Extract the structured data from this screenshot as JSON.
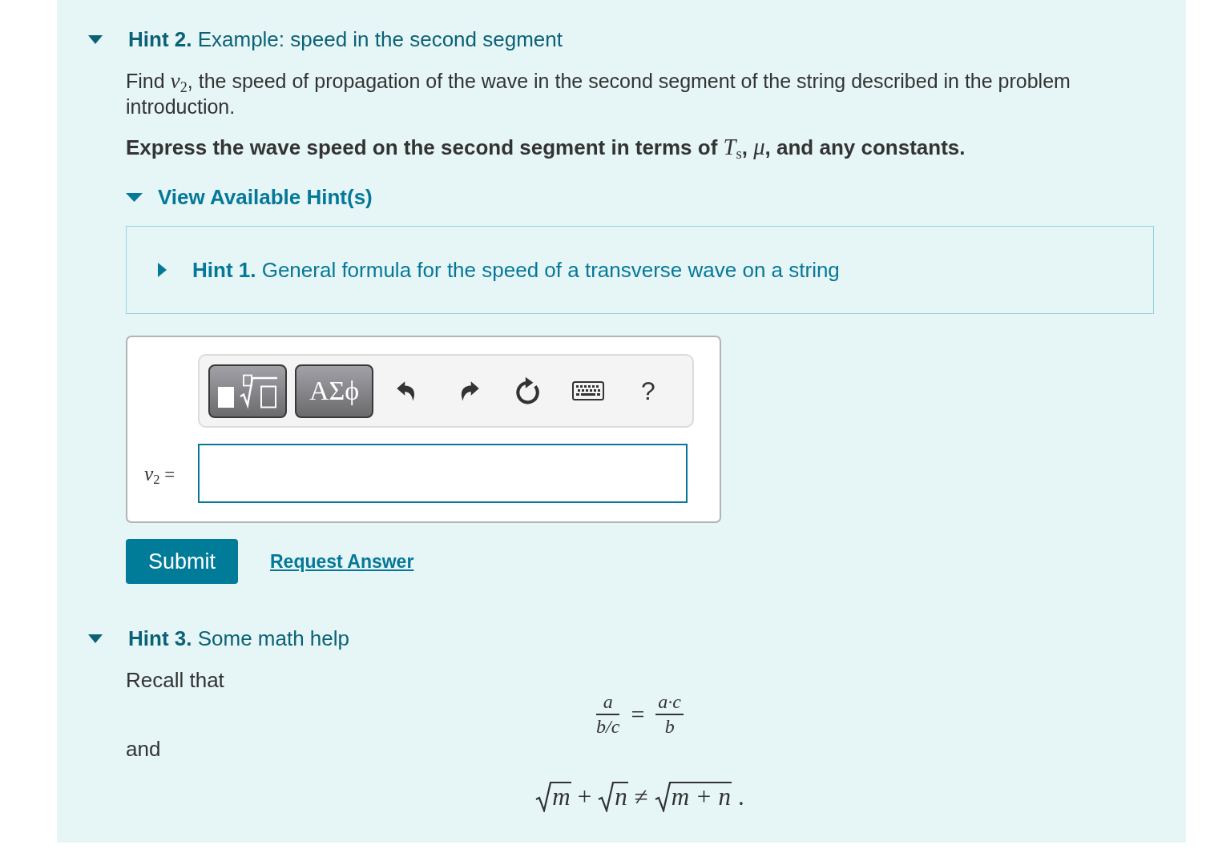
{
  "hints": [
    {
      "kind": "exercise",
      "label": "Hint 2.",
      "title": "Example: speed in the second segment",
      "expanded": true,
      "prompt": "Find *v*$_{2}$, the speed of propagation of the wave in the second segment of the string described in the problem introduction.",
      "instruction": "Express the wave speed on the second segment in terms of *T*$_{s}$, *μ*, and any constants.",
      "hint_list": {
        "label": "View Available Hint(s)",
        "expanded": true,
        "hints": [
          {
            "label": "Hint 1.",
            "title": "General formula for the speed of a transverse wave on a string",
            "expanded": false
          }
        ]
      },
      "toolbar": [
        {
          "kind": "templates"
        },
        {
          "kind": "symbols",
          "label": "ΑΣϕ"
        },
        {
          "kind": "undo"
        },
        {
          "kind": "redo"
        },
        {
          "kind": "reset"
        },
        {
          "kind": "keyboard"
        },
        {
          "kind": "help",
          "label": "?"
        }
      ],
      "answer": {
        "label": "*v*$_{2}$ ="
      },
      "buttons": {
        "submit": "Submit",
        "request_answer": "Request Answer"
      }
    },
    {
      "kind": "math",
      "label": "Hint 3.",
      "title": "Some math help",
      "expanded": true,
      "content": [
        {
          "kind": "text",
          "text": "Recall that"
        },
        {
          "kind": "fraction_equation",
          "left": {
            "numerator": "a",
            "denominator": "b/c"
          },
          "relation": "=",
          "right": {
            "numerator": "a·c",
            "denominator": "b"
          }
        },
        {
          "kind": "text",
          "text": "and"
        },
        {
          "kind": "expression",
          "parts": [
            {
              "kind": "sqrt",
              "text": "m"
            },
            {
              "kind": "op",
              "text": "+"
            },
            {
              "kind": "sqrt",
              "text": "n"
            },
            {
              "kind": "op",
              "text": "≠"
            },
            {
              "kind": "sqrt",
              "text": "m + n"
            },
            {
              "kind": "op",
              "text": "."
            }
          ]
        }
      ]
    }
  ]
}
